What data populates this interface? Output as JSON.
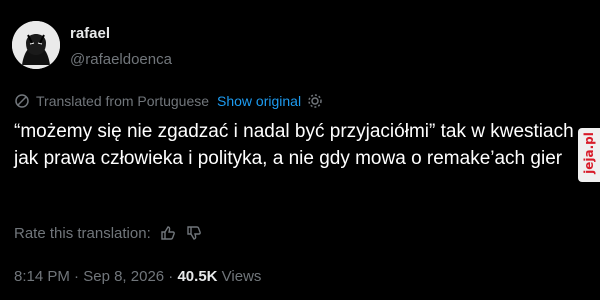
{
  "user": {
    "name": "rafael",
    "handle": "@rafaeldoenca"
  },
  "translation": {
    "note": "Translated from Portuguese",
    "show_original": "Show original"
  },
  "tweet": {
    "text": "“możemy się nie zgadzać i nadal być przyjaciółmi” tak w kwestiach jak prawa człowieka i polityka, a nie gdy mowa o remake’ach gier"
  },
  "rate": {
    "label": "Rate this translation:"
  },
  "meta": {
    "time": "8:14 PM",
    "date": "Sep 8, 2026",
    "views_count": "40.5K",
    "views_label": "Views"
  },
  "watermark": {
    "text": "jeja.pl"
  },
  "icons": {
    "translate": "translate-icon",
    "settings": "settings-icon",
    "thumbs_up": "thumbs-up-icon",
    "thumbs_down": "thumbs-down-icon"
  },
  "colors": {
    "background": "#000000",
    "text": "#e7e9ea",
    "muted": "#71767b",
    "link": "#1d9bf0"
  }
}
